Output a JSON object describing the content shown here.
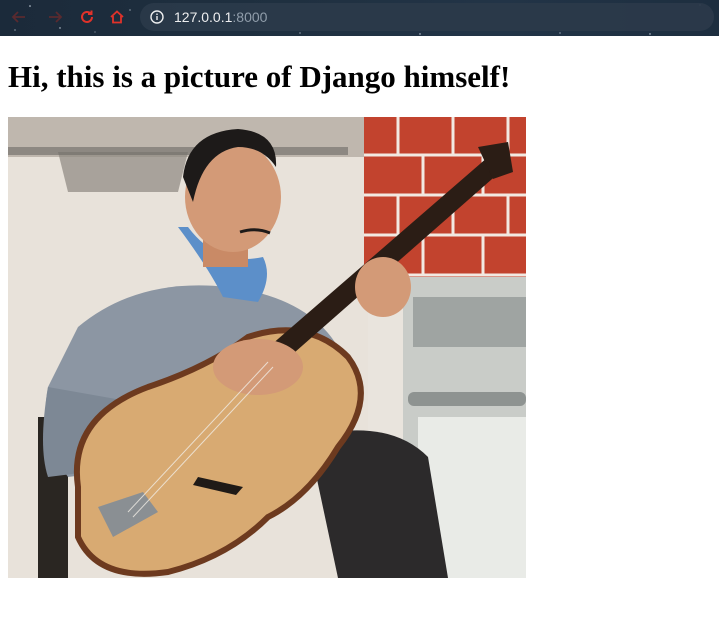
{
  "browser": {
    "url_host": "127.0.0.1",
    "url_port": ":8000",
    "icons": {
      "back": "arrow-left-icon",
      "forward": "arrow-right-icon",
      "reload": "reload-icon",
      "home": "home-icon",
      "info": "info-circle-icon"
    },
    "colors": {
      "toolbar": "#1d2e3f",
      "nav_icons": "#e0322a"
    }
  },
  "page": {
    "heading": "Hi, this is a picture of Django himself!",
    "image": {
      "subject": "guitarist-photo"
    }
  }
}
